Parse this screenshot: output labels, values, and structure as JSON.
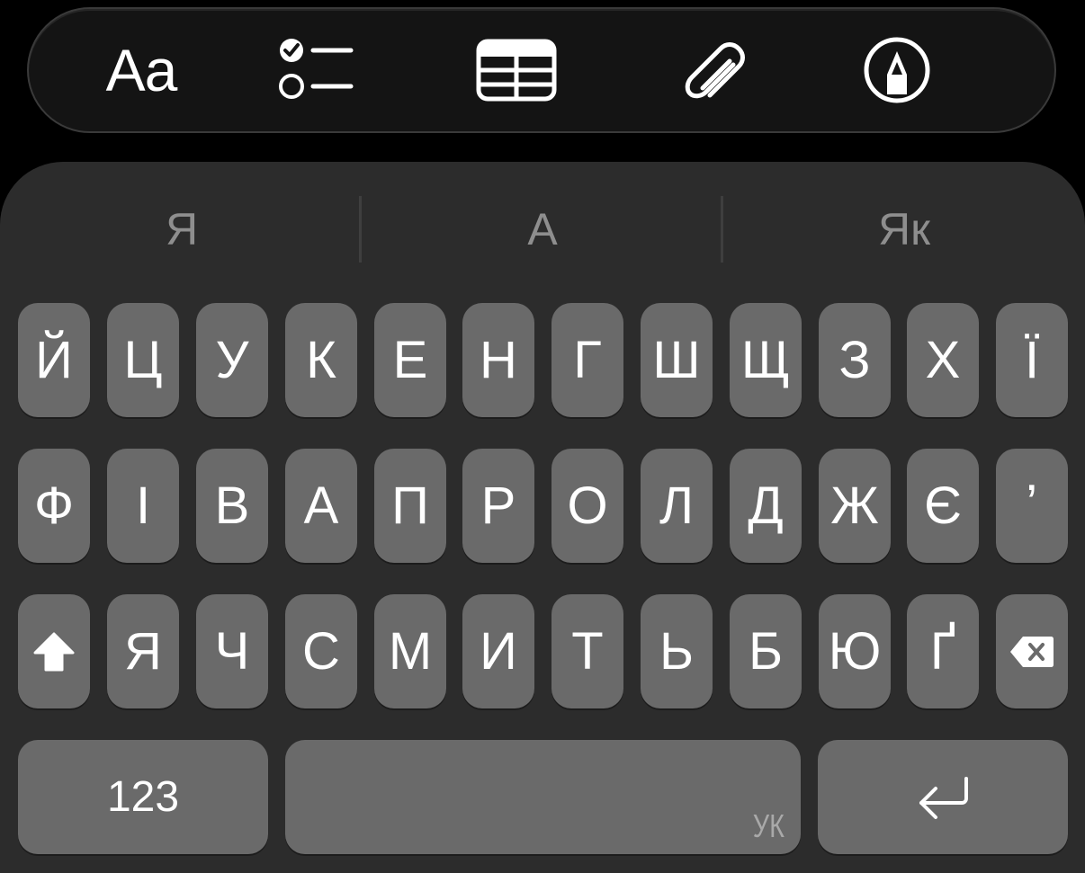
{
  "toolbar": {
    "format_label": "Aa",
    "icons": [
      "text-format",
      "checklist-icon",
      "table-icon",
      "paperclip-icon",
      "markup-pen-icon"
    ]
  },
  "suggestions": [
    "Я",
    "А",
    "Як"
  ],
  "rows": [
    [
      "Й",
      "Ц",
      "У",
      "К",
      "Е",
      "Н",
      "Г",
      "Ш",
      "Щ",
      "З",
      "Х",
      "Ї"
    ],
    [
      "Ф",
      "І",
      "В",
      "А",
      "П",
      "Р",
      "О",
      "Л",
      "Д",
      "Ж",
      "Є",
      "ʼ"
    ],
    [
      "Я",
      "Ч",
      "С",
      "М",
      "И",
      "Т",
      "Ь",
      "Б",
      "Ю",
      "Ґ"
    ]
  ],
  "bottom_row": {
    "numbers_label": "123",
    "space_language": "УК"
  },
  "colors": {
    "background": "#000000",
    "keyboard": "#2c2c2c",
    "key": "#6a6a6a",
    "key_text": "#ffffff",
    "suggestion_text": "#8e8e8e"
  }
}
